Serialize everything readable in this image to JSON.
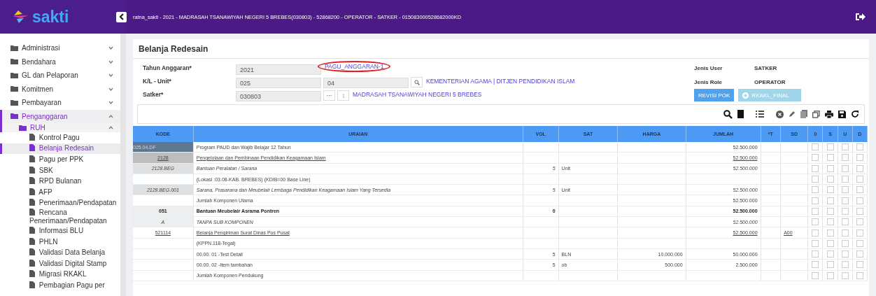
{
  "header": {
    "logo": "sakti",
    "info": "ratna_sakti - 2021 - MADRASAH TSANAWIYAH NEGERI 5 BREBES(030803) - 52868200 - OPERATOR - SATKER - 015083000528682000KD"
  },
  "sidebar": {
    "items": [
      {
        "label": "Administrasi",
        "expanded": false,
        "selected": false
      },
      {
        "label": "Bendahara",
        "expanded": false,
        "selected": false
      },
      {
        "label": "GL dan Pelaporan",
        "expanded": false,
        "selected": false
      },
      {
        "label": "Komitmen",
        "expanded": false,
        "selected": false
      },
      {
        "label": "Pembayaran",
        "expanded": false,
        "selected": false
      },
      {
        "label": "Penganggaran",
        "expanded": true,
        "selected": true,
        "children": [
          {
            "label": "RUH",
            "expanded": true,
            "selected": true,
            "children": [
              {
                "label": "Kontrol Pagu",
                "selected": false
              },
              {
                "label": "Belanja Redesain",
                "selected": true
              },
              {
                "label": "Pagu per PPK",
                "selected": false
              },
              {
                "label": "SBK",
                "selected": false
              },
              {
                "label": "RPD Bulanan",
                "selected": false
              },
              {
                "label": "AFP",
                "selected": false
              },
              {
                "label": "Penerimaan/Pendapatan",
                "selected": false
              },
              {
                "label": "Rencana Penerimaan/Pendapatan",
                "selected": false
              },
              {
                "label": "Informasi BLU",
                "selected": false
              },
              {
                "label": "PHLN",
                "selected": false
              },
              {
                "label": "Validasi Data Belanja",
                "selected": false
              },
              {
                "label": "Validasi Digital Stamp",
                "selected": false
              },
              {
                "label": "Migrasi RKAKL",
                "selected": false
              },
              {
                "label": "Pembagian Pagu per",
                "selected": false
              }
            ]
          }
        ]
      }
    ]
  },
  "page": {
    "title": "Belanja Redesain"
  },
  "form": {
    "tahun_label": "Tahun Anggaran*",
    "tahun_value": "2021",
    "pagu_link": "PAGU_ANGGARAN-1",
    "kl_label": "K/L - Unit*",
    "kl_value": "025",
    "unit_value": "04",
    "kl_name": "KEMENTERIAN AGAMA | DITJEN PENDIDIKAN ISLAM",
    "satker_label": "Satker*",
    "satker_value": "030803",
    "more_button": "···",
    "info_button": "⁝",
    "satker_name": "MADRASAH TSANAWIYAH NEGERI 5 BREBES",
    "jenis_user_label": "Jenis User",
    "jenis_user": "SATKER",
    "jenis_role_label": "Jenis Role",
    "jenis_role": "OPERATOR",
    "revisi_button": "REVISI POK",
    "rkakl_button": {
      "label": "RKAKL_FINAL",
      "disabled": true
    }
  },
  "table": {
    "columns": [
      "KODE",
      "URAIAN",
      "VOL",
      "SAT",
      "HARGA",
      "JUMLAH",
      "*T",
      "SD",
      "0",
      "S",
      "U",
      "D"
    ],
    "rows": [
      {
        "kind": "program",
        "kode": "025.04.DF",
        "uraian": "Program PAUD dan Wajib Belajar 12 Tahun",
        "vol": "",
        "sat": "",
        "harga": "",
        "jumlah": "52.500.000",
        "sd": "",
        "checked": [
          false,
          false,
          false,
          false
        ]
      },
      {
        "kind": "kegiatan",
        "kode": "2128",
        "uraian": "Pengelolaan dan Pembinaan Pendidikan Keagamaan Islam",
        "vol": "",
        "sat": "",
        "harga": "",
        "jumlah": "52.500.000",
        "sd": "",
        "checked": [
          false,
          false,
          false,
          false
        ]
      },
      {
        "kind": "output",
        "kode": "2128.BEG",
        "uraian": "Bantuan Peralatan / Sarana",
        "vol": "5",
        "sat": "Unit",
        "harga": "",
        "jumlah": "52.500.000",
        "sd": "",
        "checked": [
          false,
          false,
          false,
          false
        ]
      },
      {
        "kind": "plain",
        "kode": "",
        "uraian": "(Lokasi :03.08-KAB. BREBES) (KDIB=00 Base Line)",
        "vol": "",
        "sat": "",
        "harga": "",
        "jumlah": "",
        "sd": "",
        "checked": [
          false,
          false,
          false,
          false
        ]
      },
      {
        "kind": "suboutput",
        "kode": "2128.BEG.001",
        "uraian": "Sarana, Prasarana dan Meubelair Lembaga Pendidikan Keagamaan Islam Yang Tersedia",
        "vol": "5",
        "sat": "Unit",
        "harga": "",
        "jumlah": "52.500.000",
        "sd": "",
        "checked": [
          false,
          false,
          false,
          false
        ]
      },
      {
        "kind": "plain",
        "kode": "",
        "uraian": "Jumlah Komponen Utama",
        "vol": "",
        "sat": "",
        "harga": "",
        "jumlah": "52.500.000",
        "sd": "",
        "checked": [
          false,
          false,
          false,
          false
        ]
      },
      {
        "kind": "komponen",
        "kode": "051",
        "uraian": "Bantuan Meubelair Asrama Pontren",
        "vol": "0",
        "sat": "",
        "harga": "",
        "jumlah": "52.500.000",
        "sd": "",
        "checked": [
          false,
          false,
          false,
          false
        ]
      },
      {
        "kind": "subkomponen",
        "kode": "A",
        "uraian": "TANPA SUB KOMPONEN",
        "vol": "",
        "sat": "",
        "harga": "",
        "jumlah": "52.500.000",
        "sd": "",
        "checked": [
          false,
          false,
          false,
          false
        ]
      },
      {
        "kind": "akun",
        "kode": "521114",
        "uraian": "Belanja Pengiriman Surat Dinas Pos Pusat",
        "vol": "",
        "sat": "",
        "harga": "",
        "jumlah": "52.500.000",
        "sd": "A00",
        "checked": [
          false,
          false,
          false,
          false
        ]
      },
      {
        "kind": "plain",
        "kode": "",
        "uraian": "(KPPN.118-Tegal)",
        "vol": "",
        "sat": "",
        "harga": "",
        "jumlah": "",
        "sd": "",
        "checked": [
          false,
          false,
          false,
          false
        ]
      },
      {
        "kind": "plain",
        "kode": "",
        "uraian": "00.00. 01 -Test Detail",
        "vol": "5",
        "sat": "BLN",
        "harga": "10.000.000",
        "jumlah": "50.000.000",
        "sd": "",
        "checked": [
          false,
          false,
          false,
          false
        ]
      },
      {
        "kind": "plain",
        "kode": "",
        "uraian": "00.00. 02 -Item tambahan",
        "vol": "5",
        "sat": "ob",
        "harga": "500.000",
        "jumlah": "2.500.000",
        "sd": "",
        "checked": [
          false,
          false,
          false,
          false
        ]
      },
      {
        "kind": "plain",
        "kode": "",
        "uraian": "Jumlah Komponen Pendukung",
        "vol": "",
        "sat": "",
        "harga": "",
        "jumlah": "",
        "sd": "",
        "checked": [
          false,
          false,
          false,
          false
        ]
      }
    ]
  }
}
